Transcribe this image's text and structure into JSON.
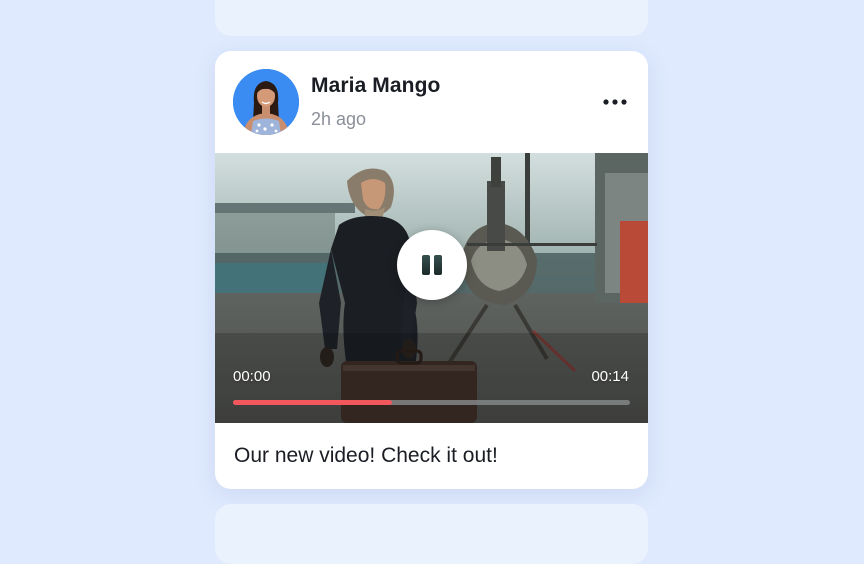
{
  "post": {
    "author": "Maria Mango",
    "timestamp": "2h ago",
    "caption": "Our new video! Check it out!",
    "menu_icon": "more-horizontal-icon",
    "avatar": "avatar-photo"
  },
  "video": {
    "state": "playing",
    "control_icon": "pause-icon",
    "current_time": "00:00",
    "total_time": "00:14",
    "progress_fraction": 0.4
  },
  "colors": {
    "page_background": "#dfeafe",
    "card_background": "#ffffff",
    "accent_progress": "#f2575d",
    "avatar_background": "#3a8bf2",
    "author_text": "#1a1d24",
    "muted_text": "#8a8f98"
  }
}
